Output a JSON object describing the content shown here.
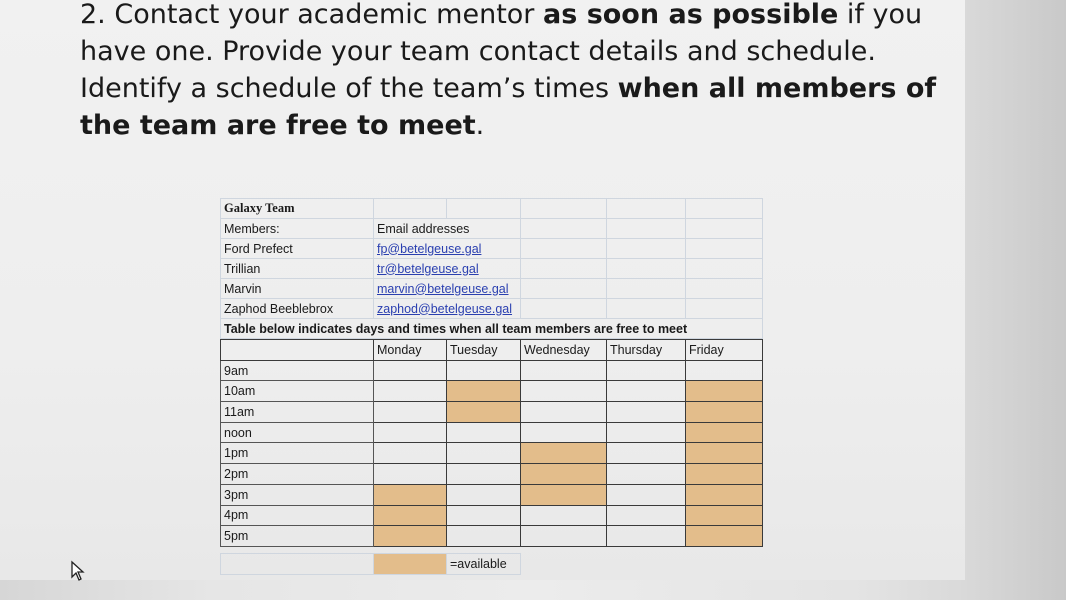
{
  "heading": {
    "p1": "2. Contact your academic mentor ",
    "b1": "as soon as possible",
    "p2": " if you have one. Provide your team contact details and schedule. Identify a schedule of the team’s times ",
    "b2": "when all members of the team are free to meet",
    "p3": "."
  },
  "team": {
    "title": "Galaxy Team",
    "members_label": "Members:",
    "email_label": "Email addresses",
    "members": [
      {
        "name": "Ford Prefect",
        "email": "fp@betelgeuse.gal"
      },
      {
        "name": "Trillian",
        "email": "tr@betelgeuse.gal"
      },
      {
        "name": "Marvin",
        "email": "marvin@betelgeuse.gal"
      },
      {
        "name": "Zaphod Beeblebrox",
        "email": "zaphod@betelgeuse.gal"
      }
    ],
    "note": "Table below indicates days and times when all team members are free to meet"
  },
  "schedule": {
    "days": [
      "Monday",
      "Tuesday",
      "Wednesday",
      "Thursday",
      "Friday"
    ],
    "times": [
      "9am",
      "10am",
      "11am",
      "noon",
      "1pm",
      "2pm",
      "3pm",
      "4pm",
      "5pm"
    ],
    "available": [
      [
        0,
        0,
        0,
        0,
        0
      ],
      [
        0,
        1,
        0,
        0,
        1
      ],
      [
        0,
        1,
        0,
        0,
        1
      ],
      [
        0,
        0,
        0,
        0,
        1
      ],
      [
        0,
        0,
        1,
        0,
        1
      ],
      [
        0,
        0,
        1,
        0,
        1
      ],
      [
        1,
        0,
        1,
        0,
        1
      ],
      [
        1,
        0,
        0,
        0,
        1
      ],
      [
        1,
        0,
        0,
        0,
        1
      ]
    ],
    "available_color": "#e3bd8b"
  },
  "legend": {
    "label": "=available"
  },
  "icons": {
    "cursor": "mouse-pointer-icon"
  }
}
